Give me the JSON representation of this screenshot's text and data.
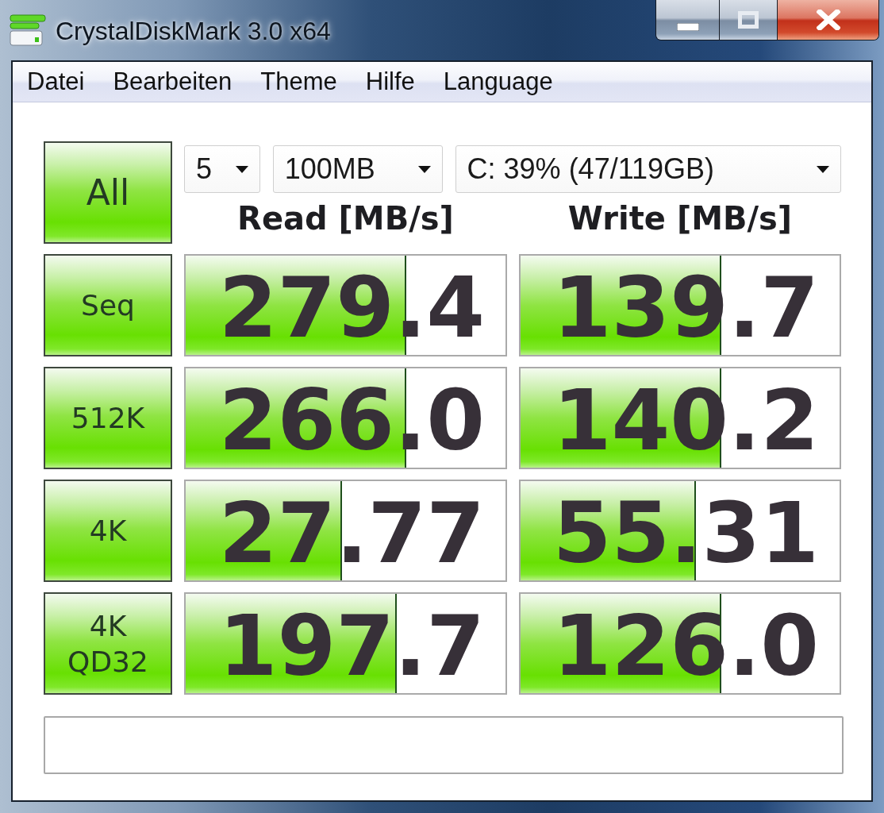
{
  "window": {
    "title": "CrystalDiskMark 3.0 x64"
  },
  "menu": [
    {
      "label": "Datei"
    },
    {
      "label": "Bearbeiten"
    },
    {
      "label": "Theme"
    },
    {
      "label": "Hilfe"
    },
    {
      "label": "Language"
    }
  ],
  "controls": {
    "run_all": "All",
    "dropdowns": [
      {
        "value": "5"
      },
      {
        "value": "100MB"
      },
      {
        "value": "C: 39% (47/119GB)"
      }
    ]
  },
  "columns": [
    "Read [MB/s]",
    "Write [MB/s]"
  ],
  "tests": [
    {
      "label": "Seq",
      "results": [
        {
          "value": "279.4",
          "level": 0.69
        },
        {
          "value": "139.7",
          "level": 0.63
        }
      ]
    },
    {
      "label": "512K",
      "results": [
        {
          "value": "266.0",
          "level": 0.69
        },
        {
          "value": "140.2",
          "level": 0.63
        }
      ]
    },
    {
      "label": "4K",
      "results": [
        {
          "value": "27.77",
          "level": 0.49
        },
        {
          "value": "55.31",
          "level": 0.55
        }
      ]
    },
    {
      "label": "4K\nQD32",
      "results": [
        {
          "value": "197.7",
          "level": 0.66
        },
        {
          "value": "126.0",
          "level": 0.63
        }
      ]
    }
  ]
}
